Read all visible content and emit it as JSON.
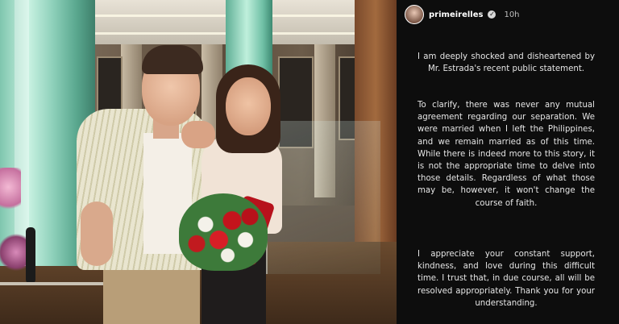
{
  "story": {
    "username": "primeirelles",
    "time": "10h",
    "verified_icon": "verified-badge-icon",
    "paragraphs": [
      "I am deeply shocked and disheartened by Mr. Estrada's recent public statement.",
      "To clarify, there was never any mutual agreement regarding our separation. We were married when I left the Philippines, and we remain married as of this time. While there is indeed more to this story, it is not the appropriate time to delve into those details. Regardless of what those may be, however, it won't change the course of faith.",
      "I appreciate your constant support, kindness, and love during this difficult time. I trust that, in due course, all will be resolved appropriately. Thank you for your understanding."
    ]
  },
  "colors": {
    "story_background": "#0d0d0d",
    "text": "#e6e6e6"
  }
}
